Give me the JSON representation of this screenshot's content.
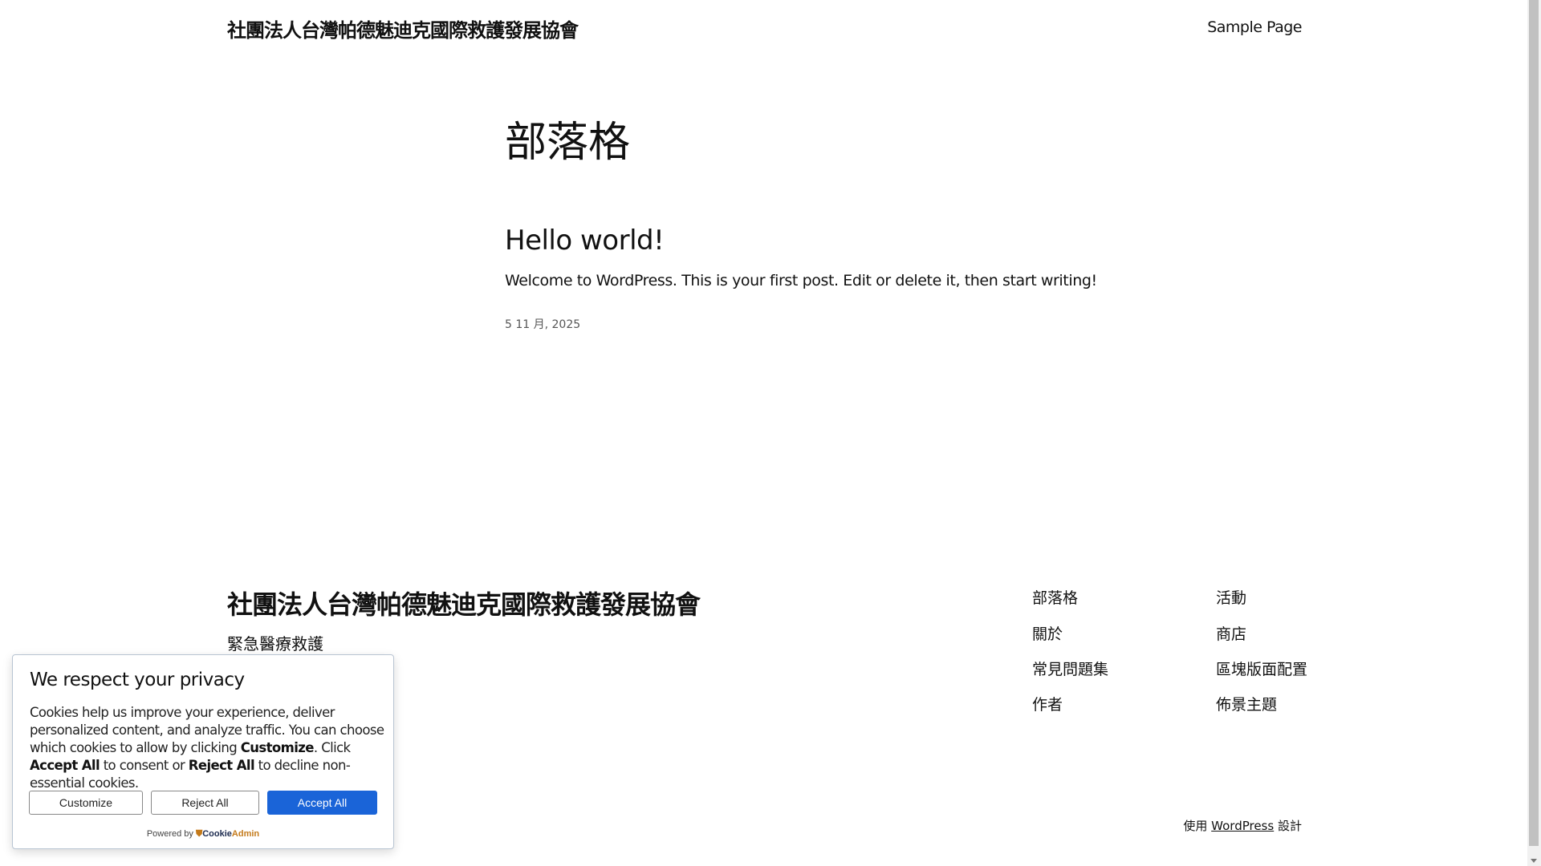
{
  "header": {
    "site_title": "社團法人台灣帕德魅迪克國際救護發展協會",
    "nav": [
      "Sample Page"
    ]
  },
  "main": {
    "heading": "部落格",
    "post": {
      "title": "Hello world!",
      "excerpt": "Welcome to WordPress. This is your first post. Edit or delete it, then start writing!",
      "date": "5 11 月, 2025"
    }
  },
  "footer": {
    "site_title": "社團法人台灣帕德魅迪克國際救護發展協會",
    "tagline": "緊急醫療救護",
    "nav_col1": [
      "部落格",
      "關於",
      "常見問題集",
      "作者"
    ],
    "nav_col2": [
      "活動",
      "商店",
      "區塊版面配置",
      "佈景主題"
    ],
    "credit_prefix": "使用",
    "credit_link": "WordPress",
    "credit_suffix": "設計"
  },
  "cookie": {
    "title": "We respect your privacy",
    "body_1": "Cookies help us improve your experience, deliver personalized content, and analyze traffic. You can choose which cookies to allow by clicking ",
    "body_b1": "Customize",
    "body_2": ". Click ",
    "body_b2": "Accept All",
    "body_3": " to consent or ",
    "body_b3": "Reject All",
    "body_4": " to decline non-essential cookies.",
    "customize": "Customize",
    "reject": "Reject All",
    "accept": "Accept All",
    "powered_by": "Powered by",
    "brand_a": "Cookie",
    "brand_b": "Admin",
    "accent": "#1a64d8"
  }
}
